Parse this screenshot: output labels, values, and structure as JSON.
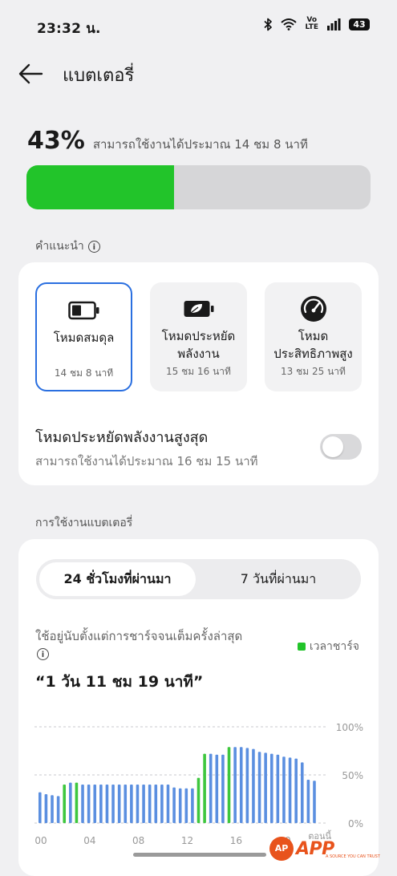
{
  "status_bar": {
    "time": "23:32 น.",
    "volte_top": "Vo",
    "volte_bottom": "LTE",
    "battery_level": "43",
    "icons": [
      "bluetooth-icon",
      "wifi-icon",
      "volte-icon",
      "signal-icon",
      "battery-icon"
    ]
  },
  "header": {
    "title": "แบตเตอรี่",
    "back_icon": "back-arrow-icon"
  },
  "summary": {
    "percent": "43%",
    "remaining": "สามารถใช้งานได้ประมาณ 14 ชม 8 นาที",
    "level_fraction": 0.43,
    "fill_color": "#22c42a"
  },
  "suggestions": {
    "label": "คำแนะนำ",
    "info_icon": "i",
    "modes": [
      {
        "name": "โหมดสมดุล",
        "time": "14 ชม 8 นาที",
        "icon": "battery-icon",
        "selected": true
      },
      {
        "name": "โหมดประหยัดพลังงาน",
        "time": "15 ชม 16 นาที",
        "icon": "leaf-battery-icon",
        "selected": false
      },
      {
        "name": "โหมดประสิทธิภาพสูง",
        "time": "13 ชม 25 นาที",
        "icon": "speedometer-icon",
        "selected": false
      }
    ],
    "super_saver": {
      "title": "โหมดประหยัดพลังงานสูงสุด",
      "subtitle": "สามารถใช้งานได้ประมาณ 16 ชม 15 นาที",
      "enabled": false
    }
  },
  "usage": {
    "section_label": "การใช้งานแบตเตอรี่",
    "tabs": [
      {
        "label": "24 ชั่วโมงที่ผ่านมา",
        "active": true
      },
      {
        "label": "7 วันที่ผ่านมา",
        "active": false
      }
    ],
    "since_charge_label": "ใช้อยู่นับตั้งแต่การชาร์จจนเต็มครั้งล่าสุด",
    "legend_label": "เวลาชาร์จ",
    "duration": "“1 วัน 11 ชม 19 นาที”"
  },
  "chart_data": {
    "type": "bar",
    "x_tick_labels": [
      "00",
      "04",
      "08",
      "12",
      "16",
      "20"
    ],
    "x_tick_hours": [
      0,
      4,
      8,
      12,
      16,
      20
    ],
    "x_last_label": "ตอนนี้",
    "y_tick_labels": [
      "100%",
      "50%",
      "0%"
    ],
    "ylim": [
      0,
      100
    ],
    "hours": [
      0,
      0.5,
      1,
      1.5,
      2,
      2.5,
      3,
      3.5,
      4,
      4.5,
      5,
      5.5,
      6,
      6.5,
      7,
      7.5,
      8,
      8.5,
      9,
      9.5,
      10,
      10.5,
      11,
      11.5,
      12,
      12.5,
      13,
      13.5,
      14,
      14.5,
      15,
      15.5,
      16,
      16.5,
      17,
      17.5,
      18,
      18.5,
      19,
      19.5,
      20,
      20.5,
      21,
      21.5,
      22,
      22.5
    ],
    "values": [
      32,
      30,
      29,
      28,
      40,
      42,
      42,
      40,
      40,
      40,
      40,
      40,
      40,
      40,
      40,
      40,
      40,
      40,
      40,
      40,
      40,
      40,
      37,
      36,
      36,
      36,
      47,
      72,
      72,
      71,
      71,
      79,
      79,
      79,
      78,
      77,
      74,
      73,
      72,
      71,
      69,
      68,
      67,
      63,
      45,
      44
    ],
    "charging": [
      false,
      false,
      false,
      false,
      true,
      false,
      true,
      false,
      false,
      false,
      false,
      false,
      false,
      false,
      false,
      false,
      false,
      false,
      false,
      false,
      false,
      false,
      false,
      false,
      false,
      false,
      true,
      true,
      false,
      false,
      false,
      true,
      false,
      false,
      false,
      false,
      false,
      false,
      false,
      false,
      false,
      false,
      false,
      false,
      false,
      false
    ],
    "grid": true,
    "colors": {
      "discharge": "#5b8fe0",
      "charge": "#3ec73e"
    }
  },
  "watermark": {
    "logo_text": "AP",
    "brand": "APP",
    "tagline": "A SOURCE YOU CAN TRUST"
  }
}
